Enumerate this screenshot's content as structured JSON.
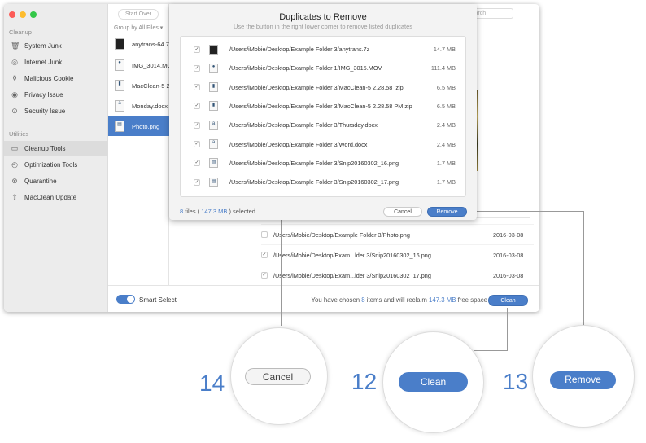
{
  "sidebar": {
    "section_cleanup": "Cleanup",
    "section_utilities": "Utilities",
    "items": [
      {
        "label": "System Junk",
        "icon": "trash-icon"
      },
      {
        "label": "Internet Junk",
        "icon": "compass-icon"
      },
      {
        "label": "Malicious Cookie",
        "icon": "cookie-icon"
      },
      {
        "label": "Privacy Issue",
        "icon": "eye-icon"
      },
      {
        "label": "Security Issue",
        "icon": "shield-icon"
      }
    ],
    "utilities": [
      {
        "label": "Cleanup Tools",
        "icon": "toolbox-icon",
        "active": true
      },
      {
        "label": "Optimization Tools",
        "icon": "gauge-icon"
      },
      {
        "label": "Quarantine",
        "icon": "quarantine-icon"
      },
      {
        "label": "MacClean Update",
        "icon": "arrow-up-icon"
      }
    ]
  },
  "files": {
    "start_over": "Start Over",
    "group_by": "Group by All Files ▾",
    "items": [
      "anytrans-64.7z",
      "IMG_3014.MOV",
      "MacClean-5 2.28.58 .zip",
      "Monday.docx",
      "Photo.png"
    ],
    "selected": "Photo.png"
  },
  "search": {
    "placeholder": "Search"
  },
  "dialog": {
    "title": "Duplicates to Remove",
    "subtitle": "Use the button in the right lower corner to remove listed duplicates",
    "rows": [
      {
        "path": "/Users/iMobie/Desktop/Example Folder 3/anytrans.7z",
        "size": "14.7 MB"
      },
      {
        "path": "/Users/iMobie/Desktop/Example Folder 1/IMG_3015.MOV",
        "size": "111.4 MB"
      },
      {
        "path": "/Users/iMobie/Desktop/Example Folder 3/MacClean-5 2.28.58 .zip",
        "size": "6.5 MB"
      },
      {
        "path": "/Users/iMobie/Desktop/Example Folder 3/MacClean-5 2.28.58 PM.zip",
        "size": "6.5 MB"
      },
      {
        "path": "/Users/iMobie/Desktop/Example Folder 3/Thursday.docx",
        "size": "2.4 MB"
      },
      {
        "path": "/Users/iMobie/Desktop/Example Folder 3/Word.docx",
        "size": "2.4 MB"
      },
      {
        "path": "/Users/iMobie/Desktop/Example Folder 3/Snip20160302_16.png",
        "size": "1.7 MB"
      },
      {
        "path": "/Users/iMobie/Desktop/Example Folder 3/Snip20160302_17.png",
        "size": "1.7 MB"
      }
    ],
    "count": "8",
    "count_suffix": " files ( ",
    "total": "147.3 MB",
    "selected_suffix": " ) selected",
    "cancel": "Cancel",
    "remove": "Remove"
  },
  "bottom_list": [
    {
      "path": "/Users/iMobie/Desktop/Example Folder 3/Photo.png",
      "date": "2016-03-08",
      "checked": false
    },
    {
      "path": "/Users/iMobie/Desktop/Exam...lder 3/Snip20160302_16.png",
      "date": "2016-03-08",
      "checked": true
    },
    {
      "path": "/Users/iMobie/Desktop/Exam...lder 3/Snip20160302_17.png",
      "date": "2016-03-08",
      "checked": true
    }
  ],
  "bottom_bar": {
    "smart_select": "Smart Select",
    "smart_select_on": true,
    "msg1": "You have chosen ",
    "items": "8",
    "msg2": " items and will reclaim ",
    "space": "147.3 MB",
    "msg3": " free space",
    "clean": "Clean"
  },
  "callouts": [
    {
      "number": "14",
      "label": "Cancel"
    },
    {
      "number": "12",
      "label": "Clean"
    },
    {
      "number": "13",
      "label": "Remove"
    }
  ],
  "colors": {
    "accent": "#4a7ec9"
  }
}
